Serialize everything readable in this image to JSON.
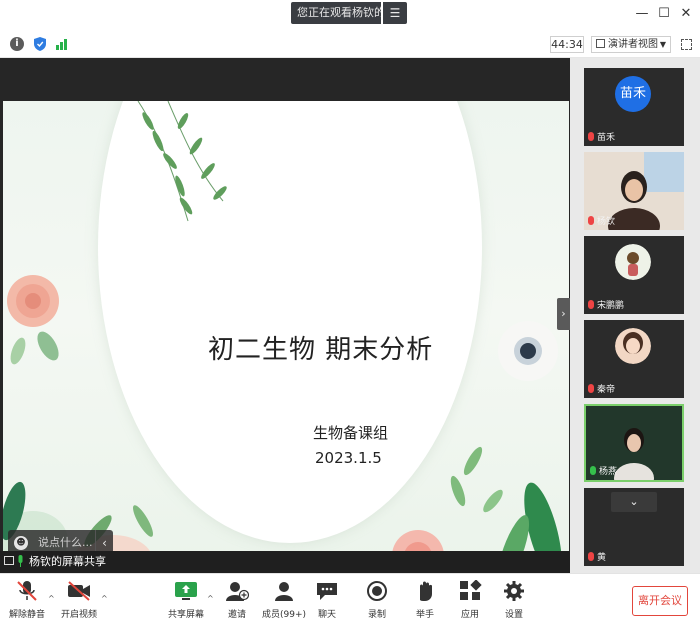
{
  "share_banner": {
    "text": "您正在观看杨钦的屏幕",
    "menu_icon": "menu-icon"
  },
  "window_controls": {
    "minimize": "—",
    "maximize": "☐",
    "close": "✕"
  },
  "status_bar": {
    "timer": "44:34",
    "view_mode": "演讲者视图"
  },
  "slide": {
    "title": "初二生物 期末分析",
    "subtitle": "生物备课组",
    "date": "2023.1.5"
  },
  "chat": {
    "placeholder": "说点什么..."
  },
  "sharer": {
    "text": "杨钦的屏幕共享"
  },
  "participants": [
    {
      "name": "苗禾",
      "avatar_text": "苗禾",
      "muted": true
    },
    {
      "name": "杨钦",
      "muted": true
    },
    {
      "name": "宋鹏鹏",
      "muted": true
    },
    {
      "name": "秦帝",
      "muted": true
    },
    {
      "name": "杨燕",
      "muted": false,
      "speaking": true
    },
    {
      "name": "黄",
      "muted": true
    }
  ],
  "toolbar": {
    "unmute": "解除静音",
    "video": "开启视频",
    "share": "共享屏幕",
    "invite": "邀请",
    "members": "成员(99+)",
    "chat": "聊天",
    "record": "录制",
    "raise_hand": "举手",
    "apps": "应用",
    "settings": "设置",
    "leave": "离开会议"
  },
  "colors": {
    "accent_green": "#27b14a",
    "leave_red": "#e2463c",
    "avatar_blue": "#1f6fe5"
  }
}
